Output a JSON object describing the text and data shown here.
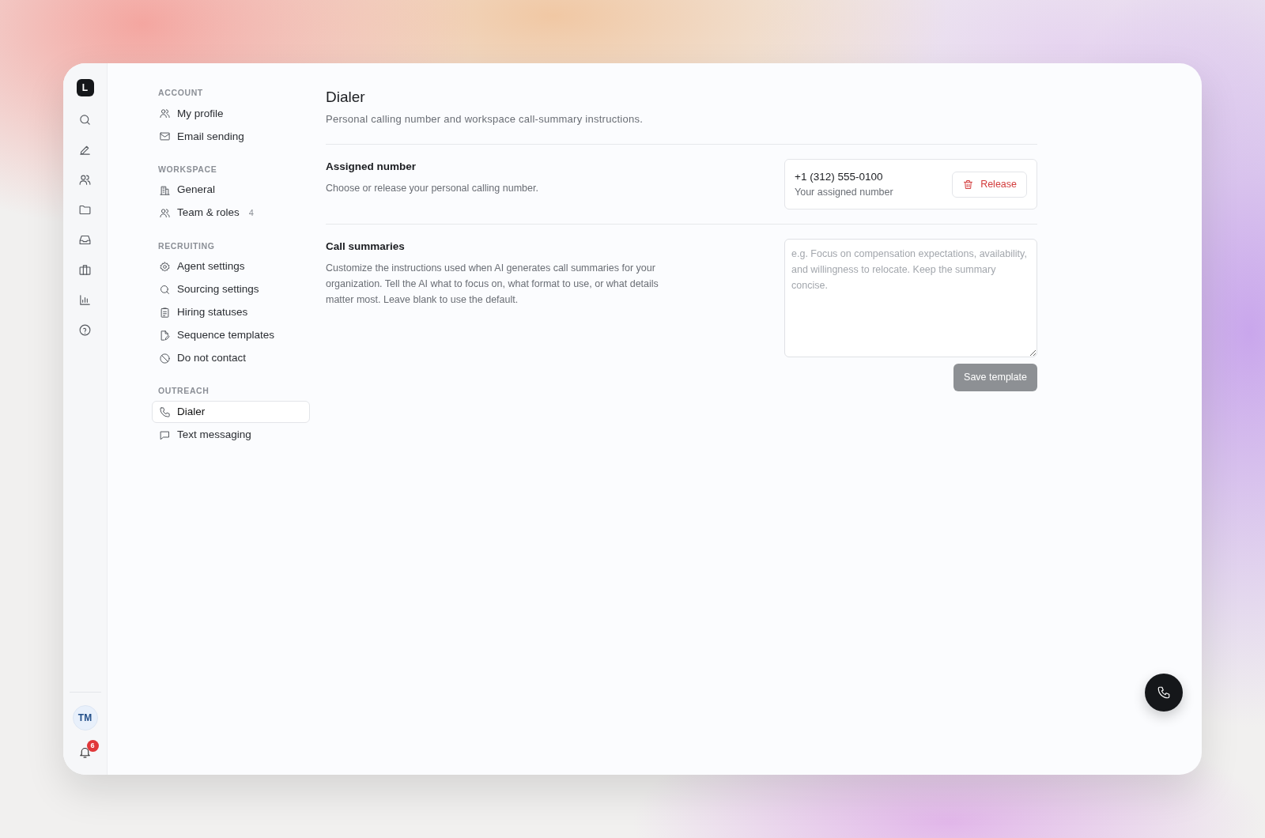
{
  "rail": {
    "logo": "L",
    "avatar": "TM",
    "notifications": "6"
  },
  "nav": {
    "sections": [
      {
        "heading": "ACCOUNT",
        "items": [
          {
            "label": "My profile",
            "selected": false
          },
          {
            "label": "Email sending",
            "selected": false
          }
        ]
      },
      {
        "heading": "WORKSPACE",
        "items": [
          {
            "label": "General",
            "selected": false
          },
          {
            "label": "Team & roles",
            "count": "4",
            "selected": false
          }
        ]
      },
      {
        "heading": "RECRUITING",
        "items": [
          {
            "label": "Agent settings",
            "selected": false
          },
          {
            "label": "Sourcing settings",
            "selected": false
          },
          {
            "label": "Hiring statuses",
            "selected": false
          },
          {
            "label": "Sequence templates",
            "selected": false
          },
          {
            "label": "Do not contact",
            "selected": false
          }
        ]
      },
      {
        "heading": "OUTREACH",
        "items": [
          {
            "label": "Dialer",
            "selected": true
          },
          {
            "label": "Text messaging",
            "selected": false
          }
        ]
      }
    ]
  },
  "page": {
    "title": "Dialer",
    "subtitle": "Personal calling number and workspace call-summary instructions."
  },
  "assigned_number": {
    "title": "Assigned number",
    "description": "Choose or release your personal calling number.",
    "number": "+1 (312) 555-0100",
    "number_caption": "Your assigned number",
    "button": "Release"
  },
  "call_summaries": {
    "title": "Call summaries",
    "description": "Customize the instructions used when AI generates call summaries for your organization. Tell the AI what to focus on, what format to use, or what details matter most. Leave blank to use the default.",
    "placeholder": "e.g. Focus on compensation expectations, availability, and willingness to relocate. Keep the summary concise.",
    "button": "Save template",
    "button_disabled": true
  }
}
